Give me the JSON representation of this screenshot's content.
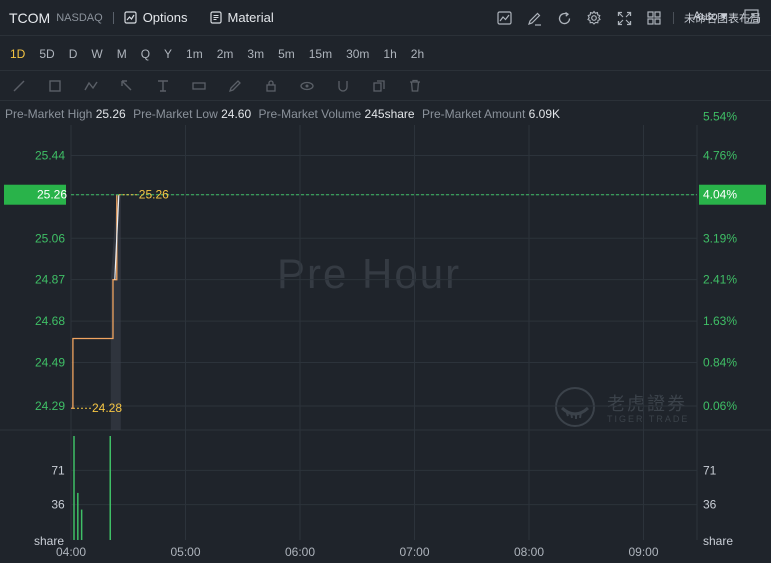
{
  "header": {
    "ticker": "TCOM",
    "exchange": "NASDAQ",
    "options_label": "Options",
    "material_label": "Material",
    "layout_label": "未命名图表布局",
    "icons": [
      "chart-settings-icon",
      "edit-icon",
      "refresh-icon",
      "gear-icon",
      "fullscreen-icon",
      "grid-layout-icon"
    ]
  },
  "timeframes": [
    "1D",
    "5D",
    "D",
    "W",
    "M",
    "Q",
    "Y",
    "1m",
    "2m",
    "3m",
    "5m",
    "15m",
    "30m",
    "1h",
    "2h"
  ],
  "active_timeframe": "1D",
  "scale_mode": "Auto",
  "stats": {
    "high_label": "Pre-Market High",
    "high": "25.26",
    "low_label": "Pre-Market Low",
    "low": "24.60",
    "volume_label": "Pre-Market Volume",
    "volume": "245share",
    "amount_label": "Pre-Market Amount",
    "amount": "6.09K"
  },
  "watermark": "Pre Hour",
  "logo": {
    "cn": "老虎證券",
    "en": "TIGER TRADE"
  },
  "colors": {
    "background": "#1f242b",
    "grid": "#2c333b",
    "price_line": "#f0a460",
    "price_highlight": "#f5c543",
    "up": "#3fbf66",
    "label_green": "#3fbf66",
    "current_price_bg": "#29b34a"
  },
  "chart_data": {
    "type": "line",
    "price": {
      "x": [
        "04:00",
        "04:01",
        "04:02",
        "04:03",
        "04:04",
        "04:05",
        "04:06",
        "04:07",
        "04:08",
        "04:09",
        "04:10",
        "04:11",
        "04:12",
        "04:13",
        "04:14",
        "04:15",
        "04:16",
        "04:17",
        "04:18",
        "04:19",
        "04:20",
        "04:21",
        "04:22",
        "04:23",
        "04:24"
      ],
      "values": [
        24.28,
        24.6,
        24.6,
        24.6,
        24.6,
        24.6,
        24.6,
        24.6,
        24.6,
        24.6,
        24.6,
        24.6,
        24.6,
        24.6,
        24.6,
        24.6,
        24.6,
        24.6,
        24.6,
        24.6,
        24.6,
        24.6,
        24.87,
        24.87,
        25.26
      ]
    },
    "max_label": "25.26",
    "min_label": "24.28",
    "current_price": "25.26",
    "current_pct": "4.04%",
    "ylim": [
      24.18,
      25.58
    ],
    "y_ticks": [
      "25.44",
      "25.26",
      "25.06",
      "24.87",
      "24.68",
      "24.49",
      "24.29"
    ],
    "y_tick_values": [
      25.44,
      25.26,
      25.06,
      24.87,
      24.68,
      24.49,
      24.29
    ],
    "pct_ticks": [
      "5.54%",
      "4.76%",
      "4.04%",
      "3.19%",
      "2.41%",
      "1.63%",
      "0.84%",
      "0.06%"
    ],
    "pct_tick_values": [
      25.62,
      25.44,
      25.26,
      25.06,
      24.87,
      24.68,
      24.49,
      24.29
    ],
    "x_ticks": [
      "04:00",
      "05:00",
      "06:00",
      "07:00",
      "08:00",
      "09:00"
    ],
    "volume": {
      "unit": "share",
      "ticks": [
        "71",
        "36"
      ],
      "tick_values": [
        71,
        36
      ],
      "ymax": 106,
      "bars": [
        {
          "x": "04:00",
          "value": 106
        },
        {
          "x": "04:02",
          "value": 48
        },
        {
          "x": "04:04",
          "value": 31
        },
        {
          "x": "04:19",
          "value": 106
        }
      ]
    }
  }
}
